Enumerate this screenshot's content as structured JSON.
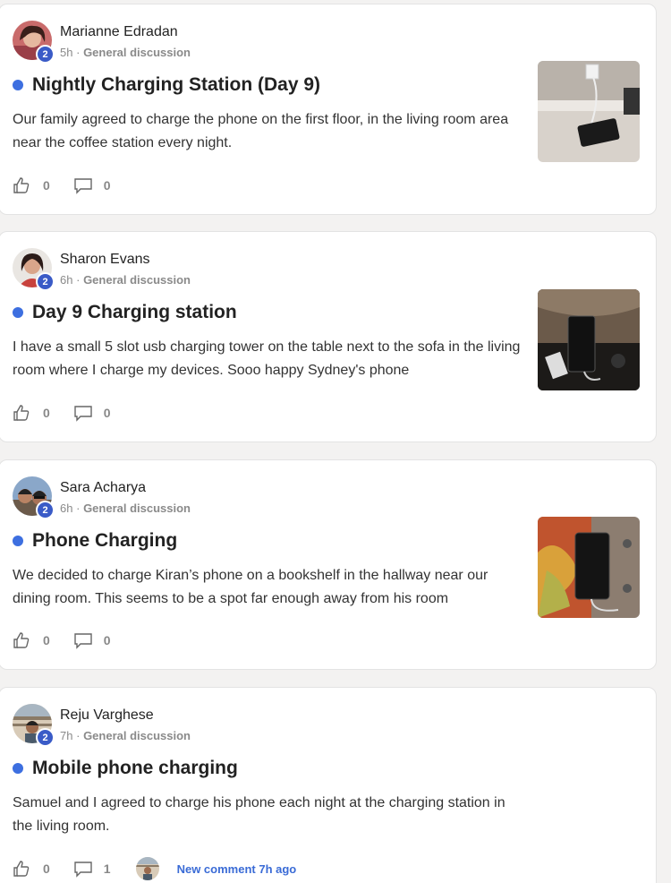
{
  "posts": [
    {
      "author": "Marianne Edradan",
      "badge": "2",
      "time": "5h",
      "separator": "·",
      "category": "General discussion",
      "title": "Nightly Charging Station (Day 9)",
      "body": "Our family agreed to charge the phone on the first floor, in the living room area near the coffee station every night.",
      "likes": "0",
      "comments": "0"
    },
    {
      "author": "Sharon Evans",
      "badge": "2",
      "time": "6h",
      "separator": "·",
      "category": "General discussion",
      "title": "Day 9 Charging station",
      "body": "I have a small 5 slot usb charging tower on the table next to the sofa in the living room where I charge my devices. Sooo happy Sydney's phone",
      "likes": "0",
      "comments": "0"
    },
    {
      "author": "Sara Acharya",
      "badge": "2",
      "time": "6h",
      "separator": "·",
      "category": "General discussion",
      "title": "Phone Charging",
      "body": "We decided to charge Kiran’s phone on a bookshelf in the hallway near our dining room. This seems to be a spot far enough away from his room",
      "likes": "0",
      "comments": "0"
    },
    {
      "author": "Reju Varghese",
      "badge": "2",
      "time": "7h",
      "separator": "·",
      "category": "General discussion",
      "title": "Mobile phone charging",
      "body": "Samuel and I agreed to charge his phone each night at the charging station in the living room.",
      "likes": "0",
      "comments": "1",
      "new_comment": "New comment 7h ago"
    }
  ],
  "icons": {
    "like": "thumbs-up-icon",
    "comment": "comment-bubble-icon"
  },
  "colors": {
    "unread_dot": "#3d6fe0",
    "badge": "#3a5bc7",
    "link": "#3a6bd6"
  }
}
